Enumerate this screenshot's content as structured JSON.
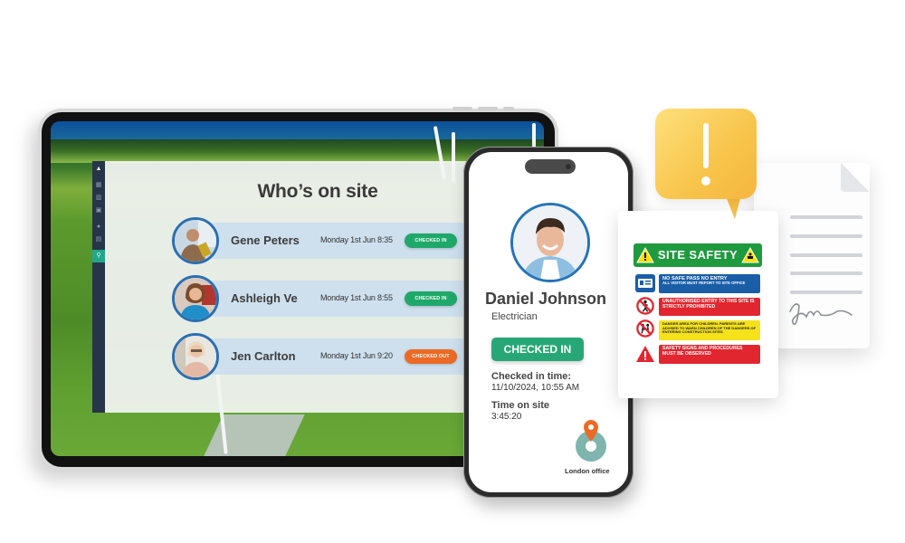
{
  "tablet": {
    "sidebar": {
      "items": [
        {
          "icon": "chevron-up-icon",
          "glyph": "▲"
        },
        {
          "icon": "dashboard-icon",
          "glyph": "▦"
        },
        {
          "icon": "chart-icon",
          "glyph": "▥"
        },
        {
          "icon": "inbox-icon",
          "glyph": "▣"
        },
        {
          "icon": "user-icon",
          "glyph": "●"
        },
        {
          "icon": "building-icon",
          "glyph": "▤"
        },
        {
          "icon": "location-icon",
          "glyph": "⚲",
          "active": true
        }
      ]
    },
    "panel": {
      "title": "Who’s on site",
      "people": [
        {
          "name": "Gene Peters",
          "time": "Monday 1st Jun 8:35",
          "status": "CHECKED IN",
          "status_type": "in"
        },
        {
          "name": "Ashleigh Ve",
          "time": "Monday 1st Jun 8:55",
          "status": "CHECKED IN",
          "status_type": "in"
        },
        {
          "name": "Jen Carlton",
          "time": "Monday 1st Jun 9:20",
          "status": "CHECKED OUT",
          "status_type": "out"
        }
      ]
    }
  },
  "phone": {
    "name": "Daniel Johnson",
    "role": "Electrician",
    "status_button": "CHECKED IN",
    "checked_in_label": "Checked in time:",
    "checked_in_value": "11/10/2024,  10:55 AM",
    "time_on_site_label": "Time on site",
    "time_on_site_value": "3:45:20",
    "location": "London office"
  },
  "safety_sign": {
    "title": "SITE SAFETY",
    "rows": [
      {
        "color": "blue",
        "icon": "id-card-icon",
        "text": "NO SAFE PASS NO ENTRY",
        "subtext": "ALL VISITOR MUST REPORT TO SITE OFFICE"
      },
      {
        "color": "red",
        "icon": "no-entry-person-icon",
        "text": "UNAUTHORISED ENTRY TO THIS SITE IS STRICTLY PROHIBITED"
      },
      {
        "color": "yellow",
        "icon": "no-children-icon",
        "text": "DANGER AREA FOR CHILDREN. PARENTS ARE ADVISED TO WARN CHILDREN OF THE DANGERS OF ENTERING CONSTRUCTION SITES"
      },
      {
        "color": "red",
        "icon": "warning-triangle-icon",
        "text": "SAFETY SIGNS AND PROCEDURES MUST BE OBSERVED"
      }
    ]
  },
  "alert": {
    "glyph": "!"
  },
  "colors": {
    "checked_in": "#1fa86a",
    "checked_out": "#ec6a24",
    "sidebar": "#263549",
    "sidebar_active": "#23a68a",
    "avatar_ring": "#2b6fb0",
    "alert_yellow": "#f8c44a",
    "safety_green": "#1f9a3e"
  }
}
